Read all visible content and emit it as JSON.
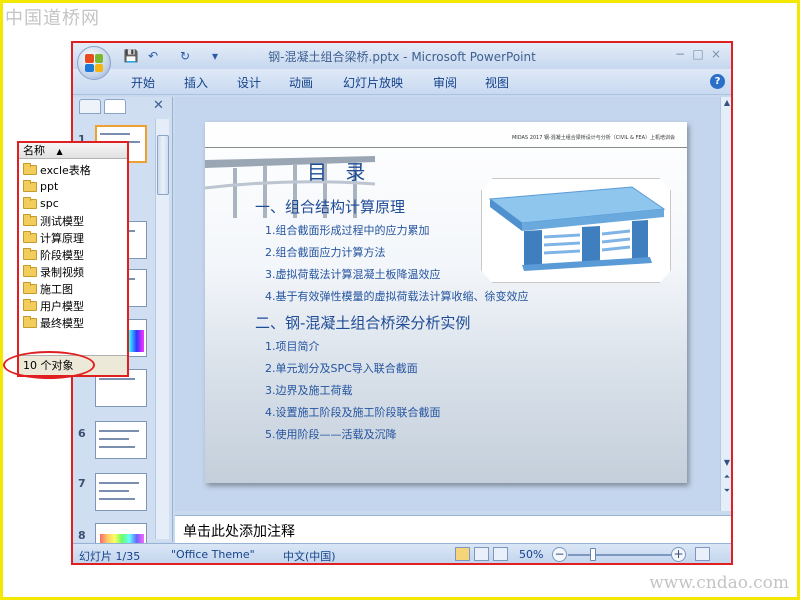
{
  "watermarks": {
    "top": "中国道桥网",
    "bottom": "www.cndao.com"
  },
  "window": {
    "title": "钢-混凝土组合梁桥.pptx - Microsoft PowerPoint"
  },
  "qat": {
    "save": "💾",
    "undo": "↶",
    "redo": "↻",
    "more": "▾"
  },
  "window_controls": {
    "minimize": "−",
    "maximize": "□",
    "close": "×"
  },
  "menu": {
    "items": [
      "开始",
      "插入",
      "设计",
      "动画",
      "幻灯片放映",
      "审阅",
      "视图"
    ],
    "help": "?"
  },
  "pane": {
    "close": "✕"
  },
  "thumbnails": {
    "visible_numbers": [
      "1",
      "6",
      "7",
      "8"
    ]
  },
  "explorer": {
    "column_header": "名称",
    "sort_arrow": "▲",
    "folders": [
      "excle表格",
      "ppt",
      "spc",
      "测试模型",
      "计算原理",
      "阶段模型",
      "录制视频",
      "施工图",
      "用户模型",
      "最终模型"
    ],
    "status": "10 个对象"
  },
  "slide": {
    "header_text": "MIDAS 2017 钢-混凝土组合梁桥设计与分析（CIVIL & FEA）上机培训会",
    "title": "目 录",
    "section1": "一、组合结构计算原理",
    "items1": [
      "1.组合截面形成过程中的应力累加",
      "2.组合截面应力计算方法",
      "3.虚拟荷载法计算混凝土板降温效应",
      "4.基于有效弹性模量的虚拟荷载法计算收缩、徐变效应"
    ],
    "section2": "二、钢-混凝土组合桥梁分析实例",
    "items2": [
      "1.项目简介",
      "2.单元划分及SPC导入联合截面",
      "3.边界及施工荷载",
      "4.设置施工阶段及施工阶段联合截面",
      "5.使用阶段——活载及沉降"
    ]
  },
  "notes": {
    "placeholder": "单击此处添加注释"
  },
  "statusbar": {
    "slide_info": "幻灯片 1/35",
    "theme": "\"Office Theme\"",
    "language": "中文(中国)",
    "zoom": "50%",
    "zoom_out": "−",
    "zoom_in": "+",
    "zoom_percent": 50
  },
  "colors": {
    "ribbon": "#c8d9f0",
    "accent_blue": "#1f4b97",
    "highlight_red": "#e02020",
    "border_yellow": "#f5e800"
  }
}
